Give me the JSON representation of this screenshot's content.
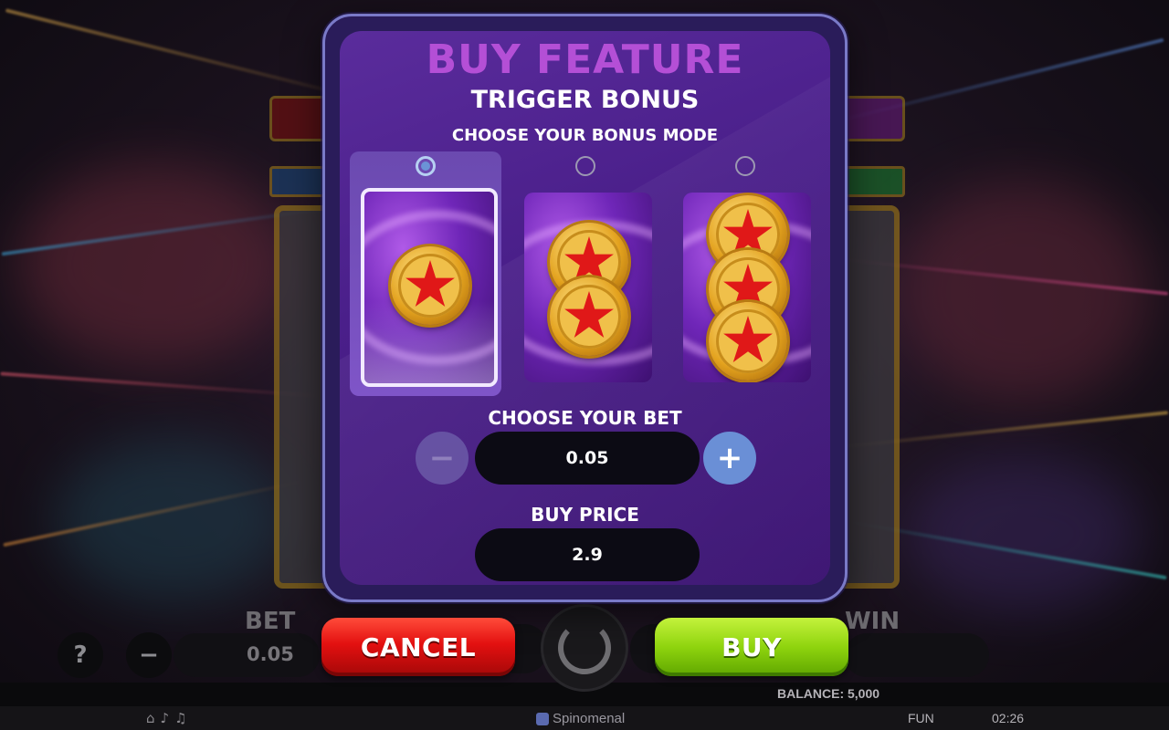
{
  "modal": {
    "title": "BUY FEATURE",
    "subtitle": "TRIGGER BONUS",
    "mode_label": "CHOOSE YOUR BONUS MODE",
    "modes": [
      {
        "id": "one-scatter",
        "selected": true,
        "coins": 1
      },
      {
        "id": "two-scatters",
        "selected": false,
        "coins": 2
      },
      {
        "id": "three-scatters",
        "selected": false,
        "coins": 3
      }
    ],
    "bet_label": "CHOOSE YOUR BET",
    "bet_value": "0.05",
    "minus_symbol": "−",
    "plus_symbol": "+",
    "price_label": "BUY PRICE",
    "price_value": "2.9",
    "cancel_label": "CANCEL",
    "buy_label": "BUY"
  },
  "background": {
    "bet_label": "BET",
    "bet_value": "0.05",
    "win_label": "WIN",
    "help_symbol": "?",
    "minus_symbol": "−",
    "balance_text": "BALANCE: 5,000",
    "brand": "Spinomenal",
    "mode_text": "FUN",
    "clock": "02:26"
  },
  "colors": {
    "title": "#b44fd6",
    "cancel": "#e31010",
    "buy": "#8fd40e",
    "plus": "#6a8fd6",
    "coin_star": "#e01818"
  }
}
